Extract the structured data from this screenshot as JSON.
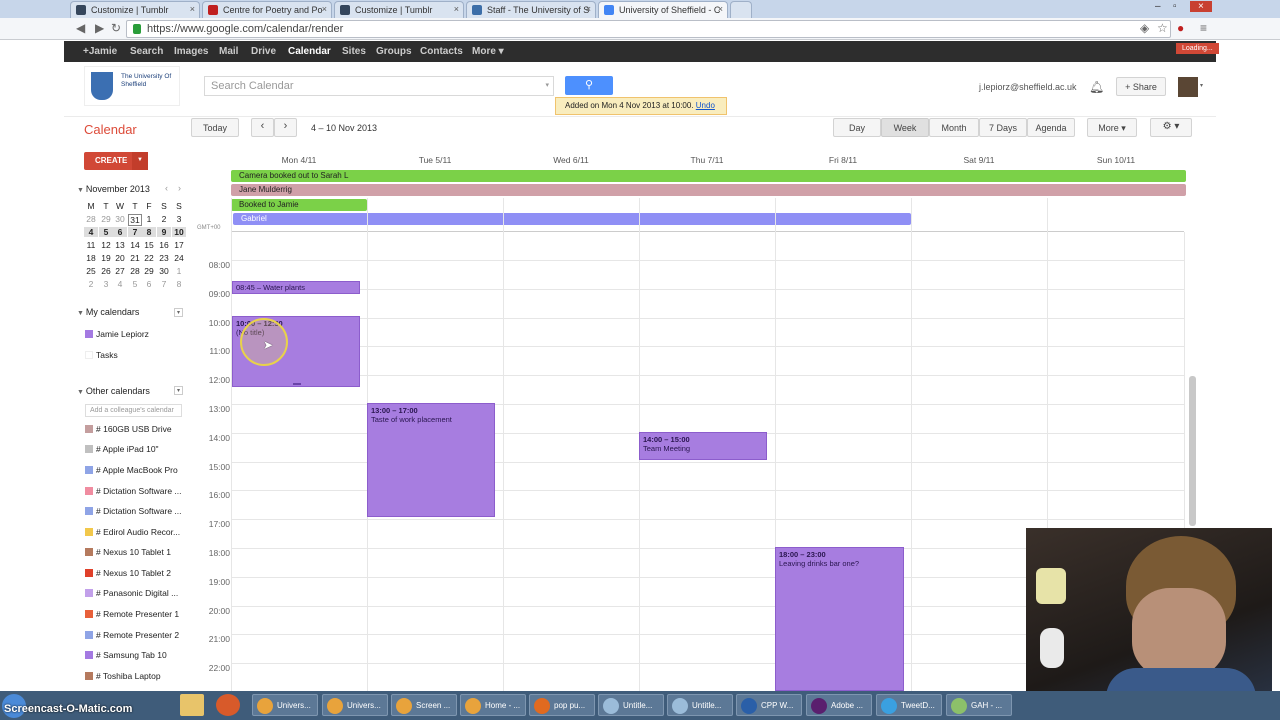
{
  "browser": {
    "tabs": [
      {
        "title": "Customize | Tumblr",
        "color": "#35465c"
      },
      {
        "title": "Centre for Poetry and Po",
        "color": "#c02020"
      },
      {
        "title": "Customize | Tumblr",
        "color": "#35465c"
      },
      {
        "title": "Staff - The University of S",
        "color": "#3c6ea8"
      },
      {
        "title": "University of Sheffield - C",
        "color": "#4285f4"
      }
    ],
    "url": "https://www.google.com/calendar/render",
    "loading": "Loading..."
  },
  "googlebar": {
    "items": [
      "+Jamie",
      "Search",
      "Images",
      "Mail",
      "Drive",
      "Calendar",
      "Sites",
      "Groups",
      "Contacts",
      "More ▾"
    ]
  },
  "header": {
    "logo_text": "The University Of Sheffield",
    "search_placeholder": "Search Calendar",
    "toast_text": "Added on Mon 4 Nov 2013 at 10:00.",
    "toast_undo": "Undo",
    "email": "j.lepiorz@sheffield.ac.uk",
    "share": "+ Share"
  },
  "toolbar": {
    "title": "Calendar",
    "today": "Today",
    "prev": "‹",
    "next": "›",
    "range": "4 – 10 Nov 2013",
    "views": [
      "Day",
      "Week",
      "Month",
      "7 Days",
      "Agenda"
    ],
    "selected_view": "Week",
    "more": "More ▾",
    "settings": "⚙ ▾"
  },
  "sidebar": {
    "create": "CREATE",
    "mini_month": "November 2013",
    "mini_days": [
      "M",
      "T",
      "W",
      "T",
      "F",
      "S",
      "S"
    ],
    "mini_weeks": [
      [
        "28",
        "29",
        "30",
        "31",
        "1",
        "2",
        "3"
      ],
      [
        "4",
        "5",
        "6",
        "7",
        "8",
        "9",
        "10"
      ],
      [
        "11",
        "12",
        "13",
        "14",
        "15",
        "16",
        "17"
      ],
      [
        "18",
        "19",
        "20",
        "21",
        "22",
        "23",
        "24"
      ],
      [
        "25",
        "26",
        "27",
        "28",
        "29",
        "30",
        "1"
      ],
      [
        "2",
        "3",
        "4",
        "5",
        "6",
        "7",
        "8"
      ]
    ],
    "my_calendars_title": "My calendars",
    "my_calendars": [
      {
        "name": "Jamie Lepiorz",
        "color": "#a47ae2"
      },
      {
        "name": "Tasks",
        "color": ""
      }
    ],
    "other_calendars_title": "Other calendars",
    "add_colleague_placeholder": "Add a colleague's calendar",
    "other_calendars": [
      {
        "name": "# 160GB USB Drive",
        "color": "#c49e9e"
      },
      {
        "name": "# Apple iPad 10\"",
        "color": "#c0c0c0"
      },
      {
        "name": "# Apple MacBook Pro",
        "color": "#8fa4e6"
      },
      {
        "name": "# Dictation Software ...",
        "color": "#f08ca0"
      },
      {
        "name": "# Dictation Software ...",
        "color": "#8fa4e6"
      },
      {
        "name": "# Edirol Audio Recor...",
        "color": "#f2c84b"
      },
      {
        "name": "# Nexus 10 Tablet 1",
        "color": "#b57a5e"
      },
      {
        "name": "# Nexus 10 Tablet 2",
        "color": "#e0402a"
      },
      {
        "name": "# Panasonic Digital ...",
        "color": "#c2a0ea"
      },
      {
        "name": "# Remote Presenter 1",
        "color": "#e8603a"
      },
      {
        "name": "# Remote Presenter 2",
        "color": "#8fa4e6"
      },
      {
        "name": "# Samsung Tab 10",
        "color": "#a47ae2"
      },
      {
        "name": "# Toshiba Laptop",
        "color": "#b57a5e"
      }
    ]
  },
  "week": {
    "days": [
      "Mon 4/11",
      "Tue 5/11",
      "Wed 6/11",
      "Thu 7/11",
      "Fri 8/11",
      "Sat 9/11",
      "Sun 10/11"
    ],
    "timezone": "GMT+00",
    "hours": [
      "08:00",
      "09:00",
      "10:00",
      "11:00",
      "12:00",
      "13:00",
      "14:00",
      "15:00",
      "16:00",
      "17:00",
      "18:00",
      "19:00",
      "20:00",
      "21:00",
      "22:00"
    ],
    "allday_events": [
      {
        "title": "Camera booked out to Sarah L",
        "color": "#7bd148"
      },
      {
        "title": "Jane Mulderrig",
        "color": "#d0a0a8"
      },
      {
        "title": "Booked to Jamie",
        "color": "#7bd148"
      },
      {
        "title": "Gabriel",
        "color": "#8f8ff5"
      }
    ],
    "events": [
      {
        "time": "08:45",
        "title": "Water plants"
      },
      {
        "time": "10:00 – 12:30",
        "title": "(No title)"
      },
      {
        "time": "13:00 – 17:00",
        "title": "Taste of work placement"
      },
      {
        "time": "14:00 – 15:00",
        "title": "Team Meeting"
      },
      {
        "time": "18:00 – 23:00",
        "title": "Leaving drinks bar one?"
      }
    ]
  },
  "taskbar": {
    "watermark": "Screencast-O-Matic.com",
    "items": [
      {
        "label": "Univers...",
        "color": "#e8a33c"
      },
      {
        "label": "Univers...",
        "color": "#e8a33c"
      },
      {
        "label": "Screen ...",
        "color": "#e8a33c"
      },
      {
        "label": "Home - ...",
        "color": "#e8a33c"
      },
      {
        "label": "pop pu...",
        "color": "#e06a20"
      },
      {
        "label": "Untitle...",
        "color": "#9bbcd9"
      },
      {
        "label": "Untitle...",
        "color": "#9bbcd9"
      },
      {
        "label": "CPP W...",
        "color": "#2a5fa8"
      },
      {
        "label": "Adobe ...",
        "color": "#5a1f6e"
      },
      {
        "label": "TweetD...",
        "color": "#3aa0e0"
      },
      {
        "label": "GAH - ...",
        "color": "#8cc06a"
      }
    ]
  }
}
